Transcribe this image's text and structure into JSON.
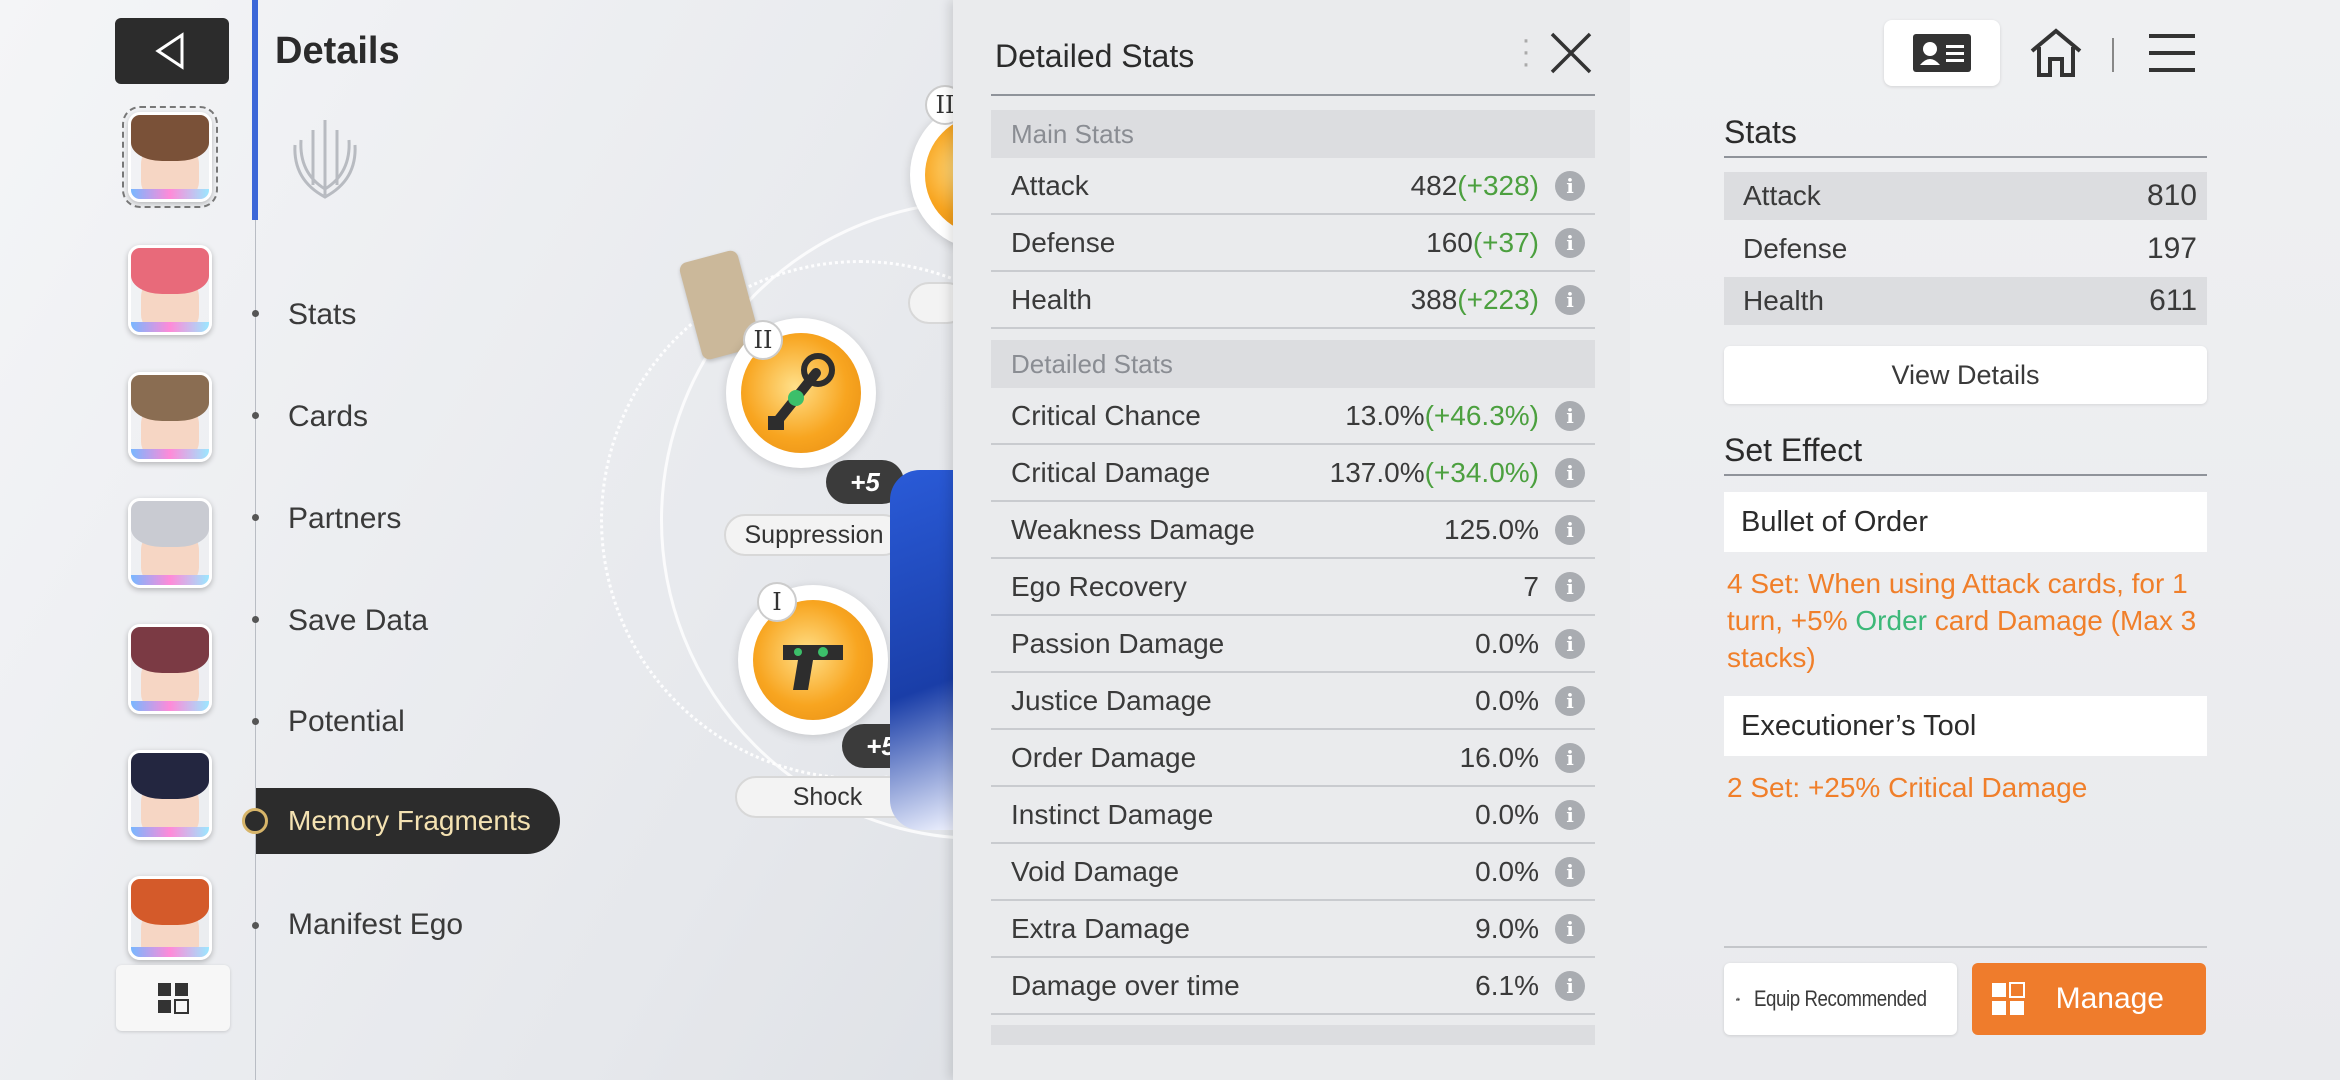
{
  "sidebar": {
    "details_title": "Details",
    "nav": [
      {
        "label": "Stats"
      },
      {
        "label": "Cards"
      },
      {
        "label": "Partners"
      },
      {
        "label": "Save Data"
      },
      {
        "label": "Potential"
      },
      {
        "label": "Memory Fragments",
        "active": true
      },
      {
        "label": "Manifest Ego"
      }
    ]
  },
  "fragments": {
    "slot1": {
      "roman": "I",
      "level": "+5",
      "name": "Shock"
    },
    "slot2": {
      "roman": "II",
      "level": "+5",
      "name": "Suppression"
    },
    "slot3": {
      "roman": "II"
    }
  },
  "detailed_stats": {
    "title": "Detailed Stats",
    "main_section": "Main Stats",
    "main": [
      {
        "label": "Attack",
        "value": "482",
        "bonus": "(+328)"
      },
      {
        "label": "Defense",
        "value": "160",
        "bonus": "(+37)"
      },
      {
        "label": "Health",
        "value": "388",
        "bonus": "(+223)"
      }
    ],
    "detail_section": "Detailed Stats",
    "detail": [
      {
        "label": "Critical Chance",
        "value": "13.0%",
        "bonus": "(+46.3%)"
      },
      {
        "label": "Critical Damage",
        "value": "137.0%",
        "bonus": "(+34.0%)"
      },
      {
        "label": "Weakness Damage",
        "value": "125.0%",
        "bonus": ""
      },
      {
        "label": "Ego Recovery",
        "value": "7",
        "bonus": ""
      },
      {
        "label": "Passion Damage",
        "value": "0.0%",
        "bonus": ""
      },
      {
        "label": "Justice Damage",
        "value": "0.0%",
        "bonus": ""
      },
      {
        "label": "Order Damage",
        "value": "16.0%",
        "bonus": ""
      },
      {
        "label": "Instinct Damage",
        "value": "0.0%",
        "bonus": ""
      },
      {
        "label": "Void Damage",
        "value": "0.0%",
        "bonus": ""
      },
      {
        "label": "Extra Damage",
        "value": "9.0%",
        "bonus": ""
      },
      {
        "label": "Damage over time",
        "value": "6.1%",
        "bonus": ""
      }
    ]
  },
  "right": {
    "stats_title": "Stats",
    "stats": [
      {
        "label": "Attack",
        "value": "810"
      },
      {
        "label": "Defense",
        "value": "197"
      },
      {
        "label": "Health",
        "value": "611"
      }
    ],
    "view_details": "View Details",
    "set_effect_title": "Set Effect",
    "set1": {
      "name": "Bullet of Order",
      "desc_a": "4 Set: When using Attack cards, for 1 turn, +5% ",
      "desc_order": "Order",
      "desc_b": " card Damage (Max 3 stacks)"
    },
    "set2": {
      "name": "Executioner’s Tool",
      "desc": "2 Set: +25% Critical Damage"
    },
    "equip_recommended": "Equip Recommended",
    "manage": "Manage"
  },
  "colors": {
    "accent_orange": "#ef7c2c",
    "bonus_green": "#4ca03f",
    "order_green": "#3cb878",
    "nav_blue": "#3c67d8"
  },
  "icons": [
    "back-arrow-icon",
    "grid-icon",
    "emblem-icon",
    "close-icon",
    "more-dots-icon",
    "id-card-icon",
    "home-icon",
    "menu-icon",
    "info-icon",
    "thumbs-up-icon",
    "manage-grid-icon"
  ]
}
